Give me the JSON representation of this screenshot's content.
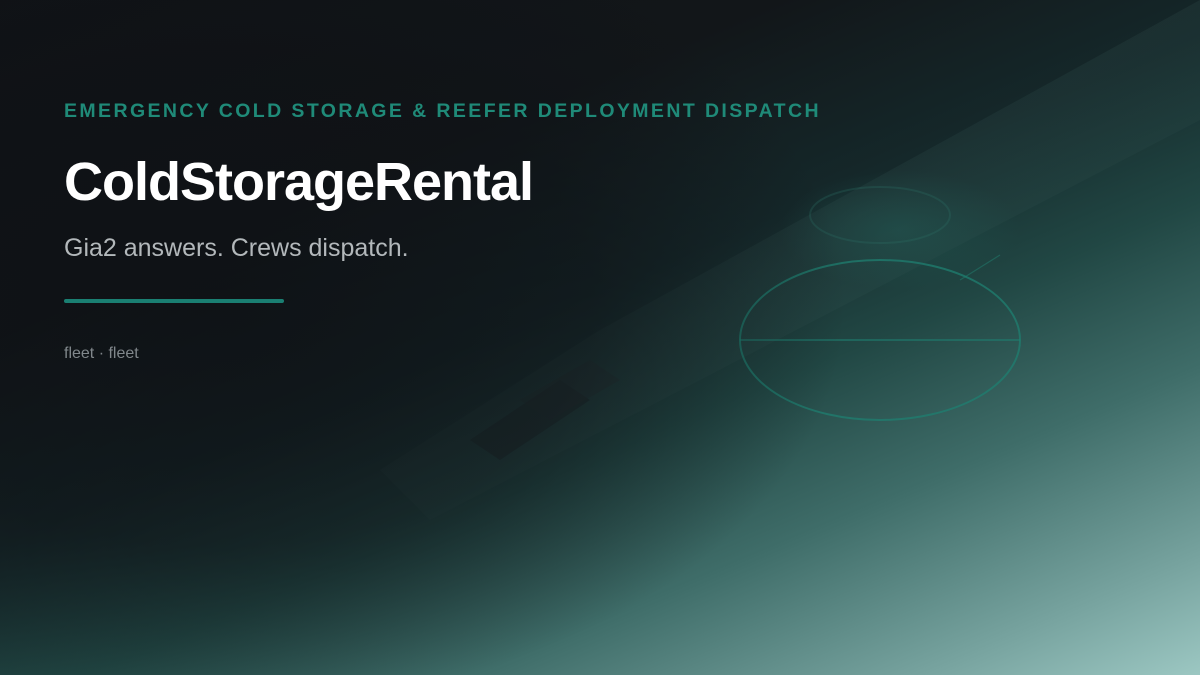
{
  "card": {
    "eyebrow": "EMERGENCY COLD STORAGE & REEFER DEPLOYMENT DISPATCH",
    "title": "ColdStorageRental",
    "tagline": "Gia2 answers. Crews dispatch.",
    "meta": {
      "left": "fleet",
      "separator": " · ",
      "right": "fleet"
    }
  },
  "colors": {
    "accent": "#1f8a78",
    "accent_rule": "#1a7f72",
    "title": "#ffffff",
    "tagline": "#b3b8bb",
    "meta": "#80878b",
    "background_dark": "#101317",
    "background_light": "#9cc7c2"
  },
  "decorations": {
    "background_motif": "dish-outline"
  }
}
